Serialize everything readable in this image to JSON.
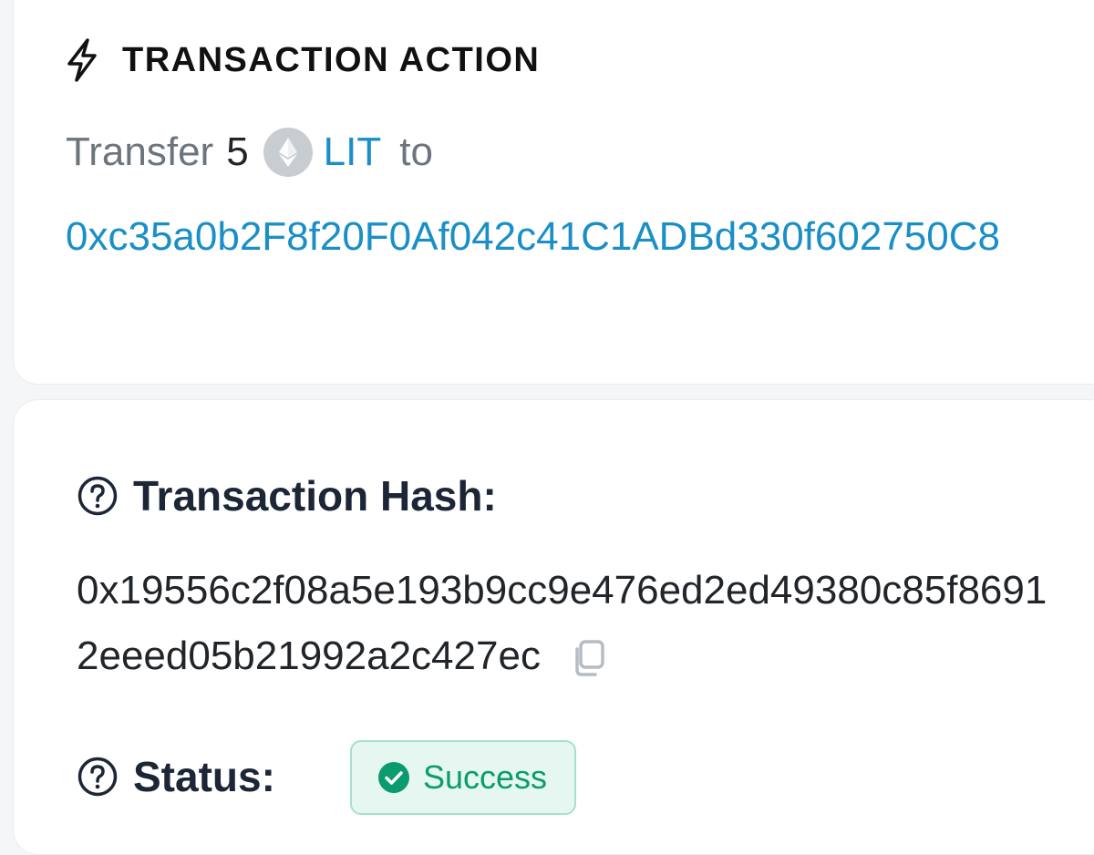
{
  "action_card": {
    "title": "TRANSACTION ACTION",
    "icon": "lightning-bolt-icon",
    "transfer": {
      "verb": "Transfer",
      "amount": "5",
      "token_icon": "ethereum-icon",
      "token_symbol": "LIT",
      "to_word": "to",
      "address": "0xc35a0b2F8f20F0Af042c41C1ADBd330f602750C8"
    }
  },
  "details_card": {
    "hash": {
      "label": "Transaction Hash:",
      "value": "0x19556c2f08a5e193b9cc9e476ed2ed49380c85f86912eeed05b21992a2c427ec",
      "copy_icon": "copy-icon"
    },
    "status": {
      "label": "Status:",
      "value": "Success",
      "icon": "check-circle-icon"
    },
    "help_icon": "question-circle-icon"
  },
  "colors": {
    "link": "#1a8fc7",
    "success_text": "#0a9c6e",
    "success_bg": "#e6f7f1",
    "success_border": "#a7e0cc",
    "muted": "#6c757d",
    "heading": "#1c2636"
  }
}
